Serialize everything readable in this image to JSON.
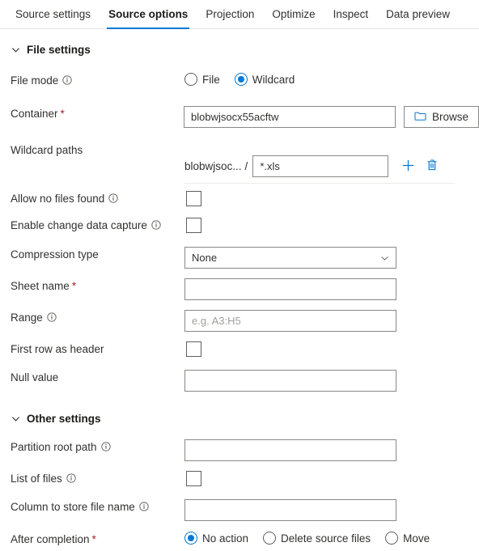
{
  "accent_color": "#0078d4",
  "required_color": "#a4262c",
  "tabs": [
    {
      "label": "Source settings",
      "active": false
    },
    {
      "label": "Source options",
      "active": true
    },
    {
      "label": "Projection",
      "active": false
    },
    {
      "label": "Optimize",
      "active": false
    },
    {
      "label": "Inspect",
      "active": false
    },
    {
      "label": "Data preview",
      "active": false
    }
  ],
  "file_settings": {
    "header": "File settings",
    "file_mode": {
      "label": "File mode",
      "options": [
        {
          "label": "File",
          "selected": false
        },
        {
          "label": "Wildcard",
          "selected": true
        }
      ]
    },
    "container": {
      "label": "Container",
      "required": "*",
      "value": "blobwjsocx55acftw",
      "browse_label": "Browse"
    },
    "wildcard_paths": {
      "label": "Wildcard paths",
      "prefix": "blobwjsoc...",
      "separator": "/",
      "value": "*.xls"
    },
    "allow_no_files_found": {
      "label": "Allow no files found",
      "checked": false
    },
    "enable_change_data_capture": {
      "label": "Enable change data capture",
      "checked": false
    },
    "compression_type": {
      "label": "Compression type",
      "value": "None"
    },
    "sheet_name": {
      "label": "Sheet name",
      "required": "*",
      "value": ""
    },
    "range": {
      "label": "Range",
      "value": "",
      "placeholder": "e.g. A3:H5"
    },
    "first_row_as_header": {
      "label": "First row as header",
      "checked": false
    },
    "null_value": {
      "label": "Null value",
      "value": ""
    }
  },
  "other_settings": {
    "header": "Other settings",
    "partition_root_path": {
      "label": "Partition root path",
      "value": ""
    },
    "list_of_files": {
      "label": "List of files",
      "checked": false
    },
    "column_to_store_file_name": {
      "label": "Column to store file name",
      "value": ""
    },
    "after_completion": {
      "label": "After completion",
      "required": "*",
      "options": [
        {
          "label": "No action",
          "selected": true
        },
        {
          "label": "Delete source files",
          "selected": false
        },
        {
          "label": "Move",
          "selected": false
        }
      ]
    }
  },
  "icons": {
    "info": "info-icon",
    "chevron_down": "chevron-down-icon",
    "folder": "folder-icon",
    "add": "plus-icon",
    "delete": "trash-icon"
  }
}
